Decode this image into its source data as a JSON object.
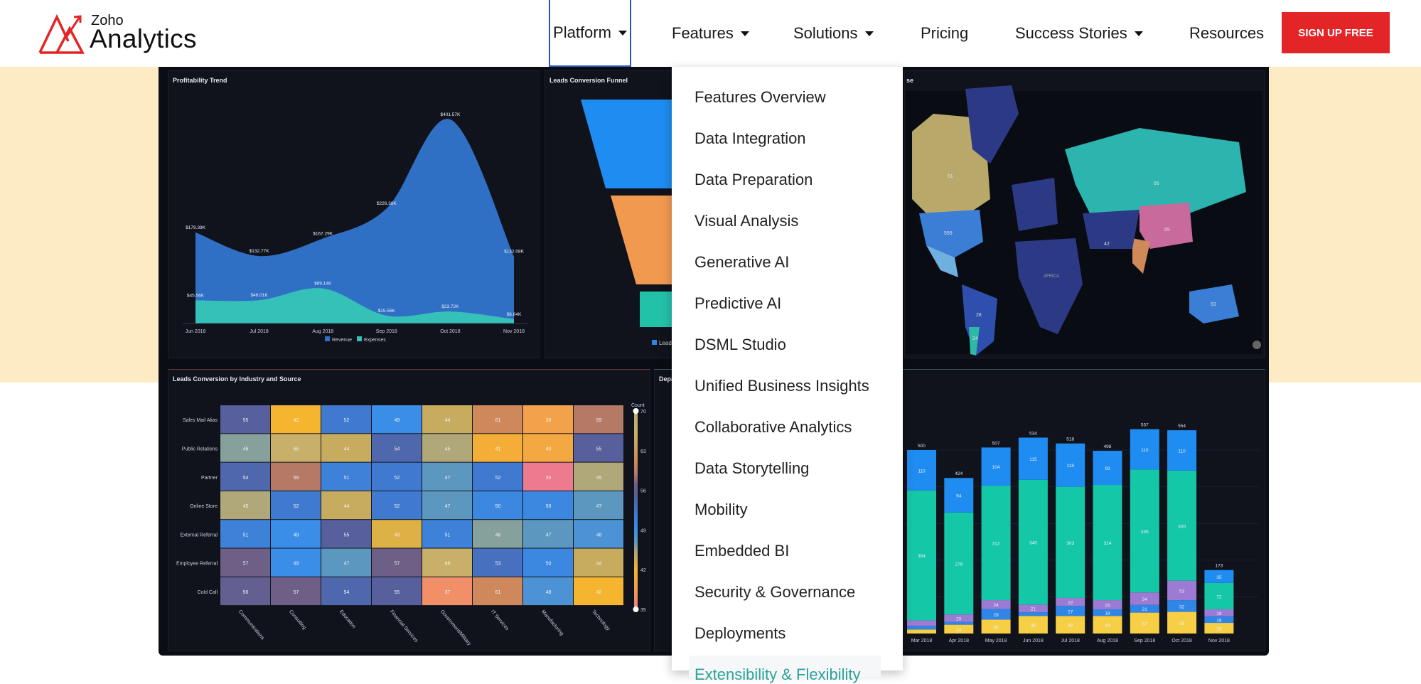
{
  "header": {
    "logo": {
      "small": "Zoho",
      "big": "Analytics",
      "brand_color": "#e42527"
    },
    "nav": [
      {
        "label": "Platform",
        "dropdown": true,
        "active": true
      },
      {
        "label": "Features",
        "dropdown": true
      },
      {
        "label": "Solutions",
        "dropdown": true
      },
      {
        "label": "Pricing",
        "dropdown": false
      },
      {
        "label": "Success Stories",
        "dropdown": true
      },
      {
        "label": "Resources",
        "dropdown": false
      }
    ],
    "cta": "SIGN UP FREE"
  },
  "menu": {
    "items": [
      "Features Overview",
      "Data Integration",
      "Data Preparation",
      "Visual Analysis",
      "Generative AI",
      "Predictive AI",
      "DSML Studio",
      "Unified Business Insights",
      "Collaborative Analytics",
      "Data Storytelling",
      "Mobility",
      "Embedded BI",
      "Security & Governance",
      "Deployments",
      "Extensibility & Flexibility"
    ]
  },
  "dashboard": {
    "funnel": {
      "title": "Leads Conversion Funnel",
      "legend": "Lead"
    },
    "map": {
      "title_fragment": "se",
      "labels": [
        "61",
        "599",
        "28",
        "24",
        "66",
        "65",
        "42",
        "53",
        "AFRICA"
      ]
    },
    "bars_title_fragment": "Depa"
  },
  "chart_data": [
    {
      "type": "area",
      "title": "Profitability Trend",
      "categories": [
        "Jun 2018",
        "Jul 2018",
        "Aug 2018",
        "Sep 2018",
        "Oct 2018",
        "Nov 2018"
      ],
      "series": [
        {
          "name": "Revenue",
          "color": "#2f6fc4",
          "values": [
            179.39,
            132.77,
            167.29,
            226.38,
            401.57,
            132.08
          ],
          "labels": [
            "$179.39K",
            "$132.77K",
            "$167.29K",
            "$226.38K",
            "$401.57K",
            "$132.08K"
          ]
        },
        {
          "name": "Expenses",
          "color": "#35c0b8",
          "values": [
            45.56,
            46.01,
            69.14,
            15.56,
            23.72,
            8.64
          ],
          "labels": [
            "$45.56K",
            "$46.01K",
            "$69.14K",
            "$15.56K",
            "$23.72K",
            "$8.64K"
          ]
        }
      ],
      "legend": "bottom"
    },
    {
      "type": "heatmap",
      "title": "Leads Conversion by Industry and Source",
      "rows": [
        "Sales Mail Alias",
        "Public Relations",
        "Partner",
        "Online Store",
        "External Referral",
        "Employee Referral",
        "Cold Call"
      ],
      "columns": [
        "Communications",
        "Consulting",
        "Education",
        "Financial Services",
        "Government/Military",
        "IT Services",
        "Manufacturing",
        "Technology"
      ],
      "values": [
        [
          55,
          42,
          52,
          49,
          44,
          61,
          39,
          59
        ],
        [
          46,
          66,
          44,
          54,
          45,
          41,
          40,
          55
        ],
        [
          54,
          59,
          51,
          52,
          47,
          52,
          35,
          45
        ],
        [
          45,
          52,
          44,
          52,
          47,
          50,
          50,
          47
        ],
        [
          51,
          49,
          55,
          43,
          51,
          46,
          47,
          48
        ],
        [
          57,
          49,
          47,
          57,
          66,
          53,
          50,
          44
        ],
        [
          56,
          57,
          54,
          55,
          37,
          61,
          48,
          42
        ]
      ],
      "colorbar": {
        "title": "Count",
        "ticks": [
          70,
          63,
          56,
          49,
          42,
          35
        ],
        "range": [
          35,
          70
        ]
      }
    },
    {
      "type": "bar",
      "stacked": true,
      "categories": [
        "Mar 2018",
        "Apr 2018",
        "May 2018",
        "Jun 2018",
        "Jul 2018",
        "Aug 2018",
        "Sep 2018",
        "Oct 2018",
        "Nov 2018"
      ],
      "totals": [
        500,
        424,
        507,
        534,
        518,
        498,
        557,
        554,
        173
      ],
      "series": [
        {
          "color": "#f7cf45",
          "values": [
            11,
            24,
            38,
            48,
            48,
            48,
            57,
            59,
            29
          ]
        },
        {
          "color": "#2f86e6",
          "values": [
            10,
            8,
            29,
            10,
            27,
            18,
            21,
            32,
            18
          ]
        },
        {
          "color": "#9b7bd4",
          "values": [
            15,
            20,
            24,
            21,
            22,
            25,
            34,
            53,
            19
          ]
        },
        {
          "color": "#14c7a6",
          "values": [
            354,
            278,
            312,
            340,
            303,
            314,
            335,
            300,
            72
          ]
        },
        {
          "color": "#1e8cf0",
          "values": [
            110,
            94,
            104,
            115,
            118,
            93,
            110,
            110,
            35
          ]
        }
      ]
    }
  ]
}
